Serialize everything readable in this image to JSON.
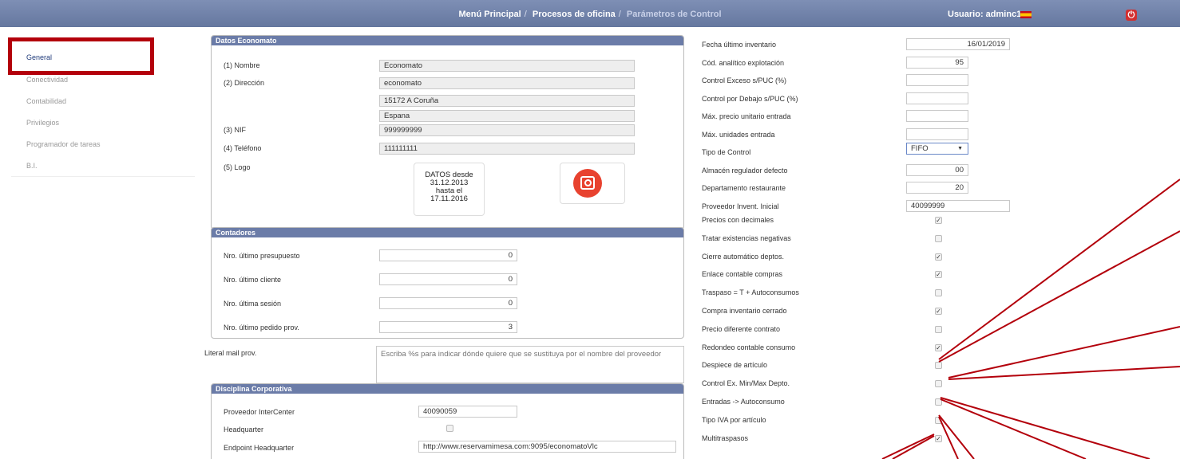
{
  "header": {
    "crumbs": [
      "Menú Principal",
      "Procesos de oficina",
      "Parámetros de Control"
    ],
    "user": "Usuario: adminc1"
  },
  "sidebar": {
    "items": [
      "General",
      "Conectividad",
      "Contabilidad",
      "Privilegios",
      "Programador de tareas",
      "B.I."
    ]
  },
  "economato": {
    "title": "Datos Economato",
    "nombre_label": "(1) Nombre",
    "nombre": "Economato",
    "direccion_label": "(2) Dirección",
    "direccion1": "economato",
    "direccion2": "15172 A Coruña",
    "direccion3": "Espana",
    "nif_label": "(3) NIF",
    "nif": "999999999",
    "telefono_label": "(4) Teléfono",
    "telefono": "111111111",
    "logo_label": "(5) Logo",
    "logo_text": [
      "DATOS desde",
      "31.12.2013",
      "hasta el",
      "17.11.2016"
    ]
  },
  "contadores": {
    "title": "Contadores",
    "items": [
      {
        "label": "Nro. último presupuesto",
        "value": "0"
      },
      {
        "label": "Nro. último cliente",
        "value": "0"
      },
      {
        "label": "Nro. última sesión",
        "value": "0"
      },
      {
        "label": "Nro. último pedido prov.",
        "value": "3"
      }
    ]
  },
  "literal_mail": {
    "label": "Literal mail prov.",
    "placeholder": "Escriba %s para indicar dónde quiere que se sustituya por el nombre del proveedor"
  },
  "disciplina": {
    "title": "Disciplina Corporativa",
    "proveedor_label": "Proveedor InterCenter",
    "proveedor": "40090059",
    "headquarter_label": "Headquarter",
    "headquarter_checked": false,
    "endpoint_label": "Endpoint Headquarter",
    "endpoint": "http://www.reservamimesa.com:9095/economatoVlc"
  },
  "params": {
    "fields": [
      {
        "label": "Fecha último inventario",
        "value": "16/01/2019"
      },
      {
        "label": "Cód. analítico explotación",
        "value": "95"
      },
      {
        "label": "Control Exceso s/PUC (%)",
        "value": ""
      },
      {
        "label": "Control por Debajo s/PUC (%)",
        "value": ""
      },
      {
        "label": "Máx. precio unitario entrada",
        "value": ""
      },
      {
        "label": "Máx. unidades entrada",
        "value": ""
      },
      {
        "label": "Tipo de Control",
        "value": "FIFO"
      },
      {
        "label": "Almacén regulador defecto",
        "value": "00"
      },
      {
        "label": "Departamento restaurante",
        "value": "20"
      },
      {
        "label": "Proveedor Invent. Inicial",
        "value": "40099999"
      }
    ],
    "checks": [
      {
        "label": "Precios con decimales",
        "checked": true
      },
      {
        "label": "Tratar existencias negativas",
        "checked": false
      },
      {
        "label": "Cierre automático deptos.",
        "checked": true
      },
      {
        "label": "Enlace contable compras",
        "checked": true
      },
      {
        "label": "Traspaso = T + Autoconsumos",
        "checked": false
      },
      {
        "label": "Compra inventario cerrado",
        "checked": true
      },
      {
        "label": "Precio diferente contrato",
        "checked": false
      },
      {
        "label": "Redondeo contable consumo",
        "checked": true
      },
      {
        "label": "Despiece de artículo",
        "checked": false
      },
      {
        "label": "Control Ex. Min/Max Depto.",
        "checked": false
      },
      {
        "label": "Entradas -> Autoconsumo",
        "checked": false
      },
      {
        "label": "Tipo IVA por artículo",
        "checked": false
      },
      {
        "label": "Multitraspasos",
        "checked": true
      }
    ]
  },
  "colors": {
    "header": "#6b7ca8",
    "highlight": "#b3000b",
    "annotation": "#b3000b"
  }
}
